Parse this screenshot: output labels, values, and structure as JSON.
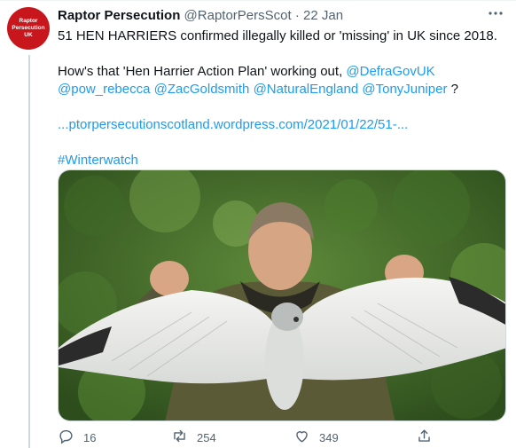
{
  "tweet": {
    "avatar_text": [
      "Raptor",
      "Persecution",
      "UK"
    ],
    "display_name": "Raptor Persecution",
    "handle": "@RaptorPersScot",
    "separator": "·",
    "date": "22 Jan",
    "line1": "51 HEN HARRIERS confirmed illegally killed or 'missing' in UK since 2018.",
    "line2_prefix": "How's that 'Hen Harrier Action Plan' working out,",
    "mentions": [
      "@DefraGovUK",
      "@pow_rebecca",
      "@ZacGoldsmith",
      "@NaturalEngland",
      "@TonyJuniper"
    ],
    "line2_suffix": "?",
    "url": "...ptorpersecutionscotland.wordpress.com/2021/01/22/51-...",
    "hashtag": "#Winterwatch"
  },
  "actions": {
    "reply_count": "16",
    "retweet_count": "254",
    "like_count": "349"
  },
  "colors": {
    "link": "#1d9bf0",
    "muted": "#536471",
    "avatar_bg": "#c8161d"
  },
  "icons": [
    "more-icon",
    "reply-icon",
    "retweet-icon",
    "like-icon",
    "share-icon"
  ]
}
